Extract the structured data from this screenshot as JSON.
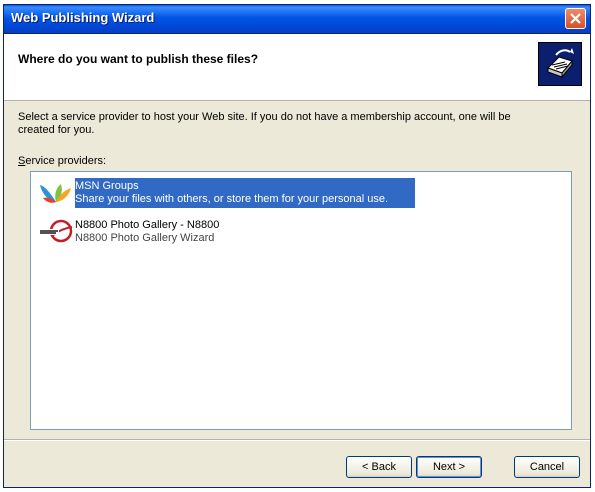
{
  "window": {
    "title": "Web Publishing Wizard"
  },
  "header": {
    "title": "Where do you want to publish these files?"
  },
  "description": "Select a service provider to host your Web site.  If you do not have a membership account, one will be created for you.",
  "providers_label": {
    "accel": "S",
    "rest": "ervice providers:"
  },
  "providers": [
    {
      "name": "MSN Groups",
      "description": "Share your files with others, or store them for your personal use.",
      "selected": true
    },
    {
      "name": "N8800 Photo Gallery - N8800",
      "description": "N8800 Photo Gallery Wizard",
      "selected": false
    }
  ],
  "buttons": {
    "back": "< Back",
    "next": "Next >",
    "cancel": "Cancel"
  },
  "colors": {
    "title_bar": "#0055e5",
    "selection": "#316ac5",
    "close_button": "#d5502c"
  }
}
